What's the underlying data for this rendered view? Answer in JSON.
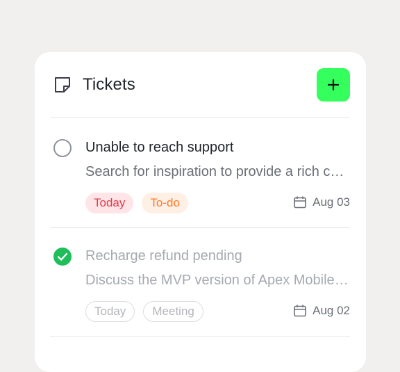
{
  "header": {
    "title": "Tickets",
    "icon": "sticky-note-icon",
    "add_icon": "plus-icon",
    "add_button_color": "#34ff5c"
  },
  "tickets": [
    {
      "title": "Unable to reach support",
      "description": "Search for inspiration to provide a rich content",
      "status": "open",
      "tags": [
        {
          "label": "Today",
          "color": "#e23a4a",
          "bg": "#ffe5e8"
        },
        {
          "label": "To-do",
          "color": "#ff7a2e",
          "bg": "#fff0e6"
        }
      ],
      "date": "Aug 03"
    },
    {
      "title": "Recharge refund pending",
      "description": "Discuss the MVP version of Apex Mobile app",
      "status": "completed",
      "tags": [
        {
          "label": "Today"
        },
        {
          "label": "Meeting"
        }
      ],
      "date": "Aug 02"
    }
  ]
}
